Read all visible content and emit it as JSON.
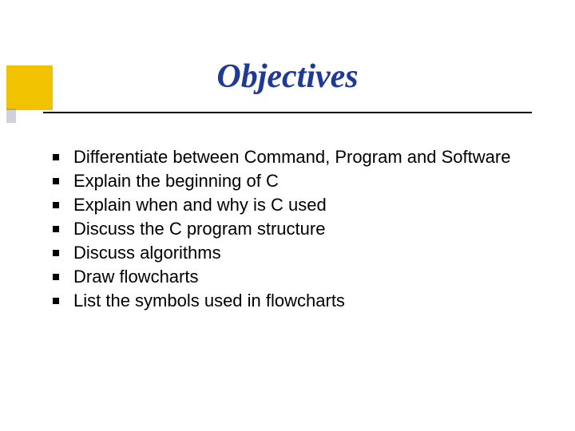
{
  "title": "Objectives",
  "bullets": [
    "Differentiate between Command, Program and Software",
    "Explain the beginning of C",
    "Explain when and why is C used",
    "Discuss the C program structure",
    "Discuss algorithms",
    "Draw flowcharts",
    "List the symbols used in flowcharts"
  ]
}
